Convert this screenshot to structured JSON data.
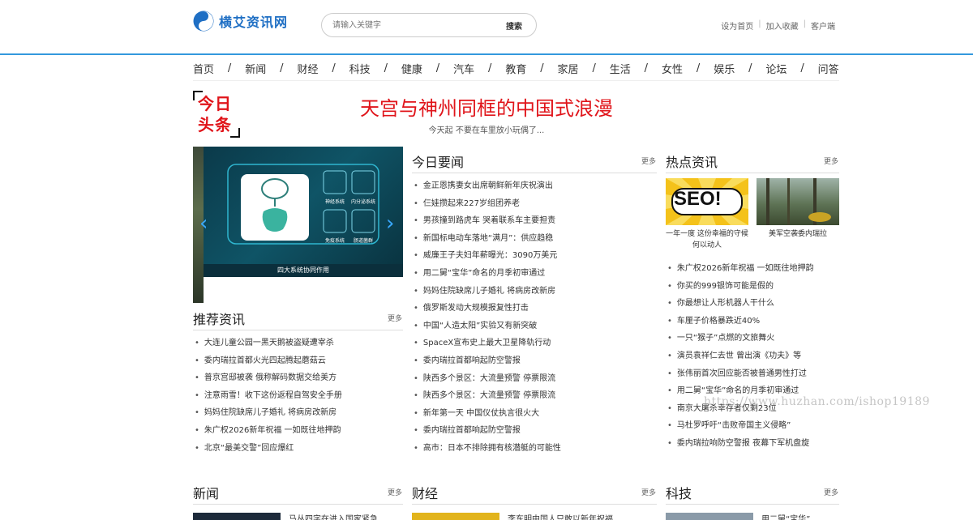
{
  "site": {
    "name": "横艾资讯网",
    "search_placeholder": "请输入关键字",
    "search_button": "搜索",
    "toplinks": [
      "设为首页",
      "加入收藏",
      "客户端"
    ]
  },
  "nav": [
    "首页",
    "新闻",
    "财经",
    "科技",
    "健康",
    "汽车",
    "教育",
    "家居",
    "生活",
    "女性",
    "娱乐",
    "论坛",
    "问答"
  ],
  "headline": {
    "logo_line1": "今日",
    "logo_line2": "头条",
    "title": "天宫与神州同框的中国式浪漫",
    "subtitle": "今天起 不要在车里放小玩偶了..."
  },
  "carousel": {
    "caption": "四大系统协同作用",
    "labels": [
      "神经系统",
      "内分泌系统",
      "免疫系统",
      "肠道菌群"
    ]
  },
  "recommend": {
    "title": "推荐资讯",
    "more": "更多",
    "items": [
      "大连儿童公园一黑天鹅被盗疑遭宰杀",
      "委内瑞拉首都火光四起腾起蘑菇云",
      "普京宫邸被袭 俄称解码数据交给美方",
      "注意雨雪！收下这份返程自驾安全手册",
      "妈妈住院缺席儿子婚礼 将病房改新房",
      "朱广权2026新年祝福 一如既往地押韵",
      "北京“最美交警”回应爆红"
    ]
  },
  "today": {
    "title": "今日要闻",
    "more": "更多",
    "items": [
      "金正恩携妻女出席朝鲜新年庆祝演出",
      "仨娃攒起来227岁组团养老",
      "男孩撞到路虎车 哭着联系车主要担责",
      "新国标电动车落地“满月”：供应趋稳",
      "威廉王子夫妇年薪曝光：3090万美元",
      "用二舅“宝华”命名的月季初审通过",
      "妈妈住院缺席儿子婚礼 将病房改新房",
      "俄罗斯发动大规模报复性打击",
      "中国“人造太阳”实验又有新突破",
      "SpaceX宣布史上最大卫星降轨行动",
      "委内瑞拉首都响起防空警报",
      "陕西多个景区：大流量预警 停票限流",
      "陕西多个景区：大流量预警 停票限流",
      "新年第一天 中国仪仗执言很火大",
      "委内瑞拉首都响起防空警报",
      "高市：日本不排除拥有核潜艇的可能性"
    ]
  },
  "hot": {
    "title": "热点资讯",
    "more": "更多",
    "thumb1_text": "SEO!",
    "thumb1_caption": "一年一度 这份幸福的守候何以动人",
    "thumb2_caption": "美军空袭委内瑞拉",
    "items": [
      "朱广权2026新年祝福 一如既往地押韵",
      "你买的999银饰可能是假的",
      "你最想让人形机器人干什么",
      "车厘子价格暴跌近40%",
      "一只“猴子”点燃的文旅舞火",
      "演员袁祥仁去世 曾出演《功夫》等",
      "张伟丽首次回应能否被普通男性打过",
      "用二舅“宝华”命名的月季初审通过",
      "南京大屠杀幸存者仅剩23位",
      "马杜罗呼吁“击败帝国主义侵略”",
      "委内瑞拉响防空警报 夜幕下军机盘旋"
    ]
  },
  "bottom": {
    "sections": [
      {
        "title": "新闻",
        "more": "更多",
        "teaser": "马丛四字在进入国家紧急"
      },
      {
        "title": "财经",
        "more": "更多",
        "teaser": "李东明中国人只敢以新年祝福"
      },
      {
        "title": "科技",
        "more": "更多",
        "teaser": "用二舅“宝华”"
      }
    ]
  },
  "watermark": "https://www.huzhan.com/ishop19189",
  "colors": {
    "accent": "#3399dd",
    "headline_red": "#e0141a",
    "logo_blue": "#1f6fc4"
  }
}
